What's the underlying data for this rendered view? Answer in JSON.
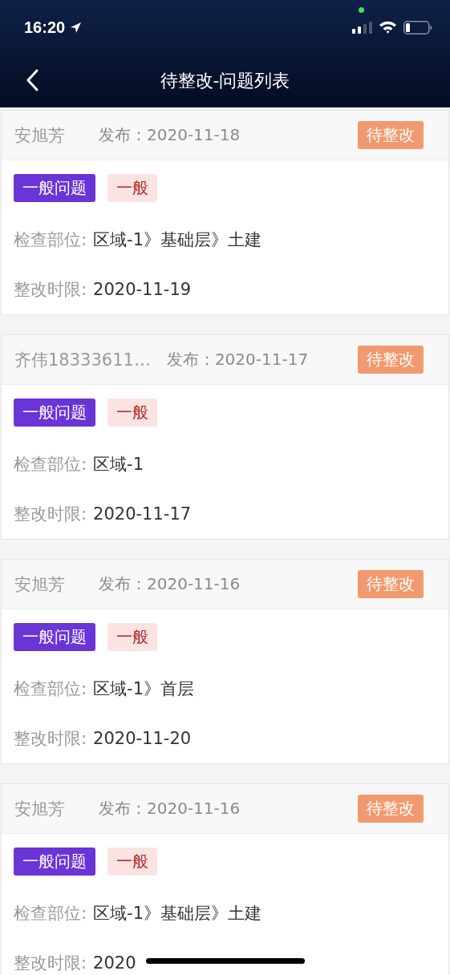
{
  "status_bar": {
    "time": "16:20"
  },
  "nav": {
    "title": "待整改-问题列表"
  },
  "issues": [
    {
      "reporter": "安旭芳",
      "published_label": "发布：",
      "published_date": "2020-11-18",
      "status": "待整改",
      "tags": [
        {
          "text": "一般问题",
          "kind": "category"
        },
        {
          "text": "一般",
          "kind": "severity"
        }
      ],
      "location_label": "检查部位:",
      "location": "区域-1》基础层》土建",
      "deadline_label": "整改时限:",
      "deadline": "2020-11-19"
    },
    {
      "reporter": "齐伟18333611…",
      "published_label": "发布：",
      "published_date": "2020-11-17",
      "status": "待整改",
      "tags": [
        {
          "text": "一般问题",
          "kind": "category"
        },
        {
          "text": "一般",
          "kind": "severity"
        }
      ],
      "location_label": "检查部位:",
      "location": "区域-1",
      "deadline_label": "整改时限:",
      "deadline": "2020-11-17"
    },
    {
      "reporter": "安旭芳",
      "published_label": "发布：",
      "published_date": "2020-11-16",
      "status": "待整改",
      "tags": [
        {
          "text": "一般问题",
          "kind": "category"
        },
        {
          "text": "一般",
          "kind": "severity"
        }
      ],
      "location_label": "检查部位:",
      "location": "区域-1》首层",
      "deadline_label": "整改时限:",
      "deadline": "2020-11-20"
    },
    {
      "reporter": "安旭芳",
      "published_label": "发布：",
      "published_date": "2020-11-16",
      "status": "待整改",
      "tags": [
        {
          "text": "一般问题",
          "kind": "category"
        },
        {
          "text": "一般",
          "kind": "severity"
        }
      ],
      "location_label": "检查部位:",
      "location": "区域-1》基础层》土建",
      "deadline_label": "整改时限:",
      "deadline": "2020"
    }
  ]
}
